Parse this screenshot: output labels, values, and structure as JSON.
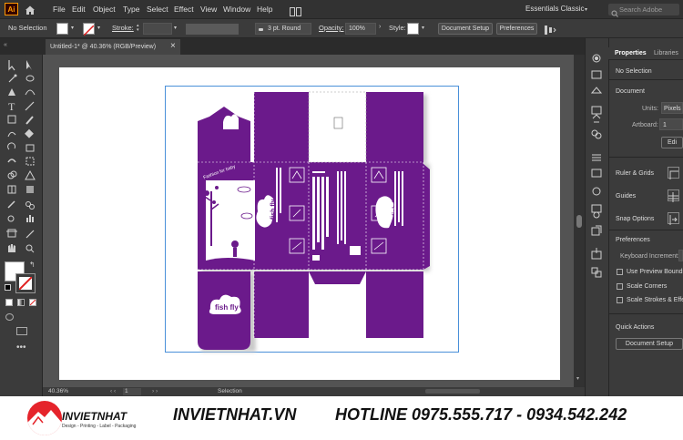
{
  "app": {
    "logo_text": "Ai"
  },
  "menu": [
    "File",
    "Edit",
    "Object",
    "Type",
    "Select",
    "Effect",
    "View",
    "Window",
    "Help"
  ],
  "workspace": {
    "label": "Essentials Classic",
    "search_placeholder": "Search Adobe Stock"
  },
  "control_bar": {
    "selection_state": "No Selection",
    "stroke_label": "Stroke:",
    "stroke_profile": "3 pt. Round",
    "opacity_label": "Opacity:",
    "opacity_value": "100%",
    "style_label": "Style:",
    "document_setup": "Document Setup",
    "preferences": "Preferences"
  },
  "document_tab": {
    "title": "Untitled-1* @ 40.36% (RGB/Preview)",
    "close": "×"
  },
  "status_bar": {
    "zoom": "40.36%",
    "artboard_number": "1",
    "tool": "Selection"
  },
  "panel": {
    "tabs": [
      "Properties",
      "Libraries"
    ],
    "no_selection": "No Selection",
    "document_title": "Document",
    "units_label": "Units:",
    "units_value": "Pixels",
    "artboard_label": "Artboard:",
    "artboard_value": "1",
    "edit_artboards": "Edi",
    "ruler_grids": "Ruler & Grids",
    "guides": "Guides",
    "snap_options": "Snap Options",
    "preferences": "Preferences",
    "keyboard_increment": "Keyboard Increment:",
    "use_preview_bounds": "Use Preview Bounds",
    "scale_corners": "Scale Corners",
    "scale_strokes": "Scale Strokes & Effects",
    "quick_actions": "Quick Actions",
    "document_setup": "Document Setup"
  },
  "artwork": {
    "brand": "fish fly",
    "cube_text": "fish fly",
    "tagline": "Fashion for baby",
    "colors": {
      "purple": "#6b1a8b",
      "canvas": "#535353"
    }
  },
  "footer": {
    "logo_name": "INVIETNHAT",
    "logo_sub": "Design - Printing - Label - Packaging",
    "site": "INVIETNHAT.VN",
    "hotline": "HOTLINE 0975.555.717 - 0934.542.242"
  }
}
